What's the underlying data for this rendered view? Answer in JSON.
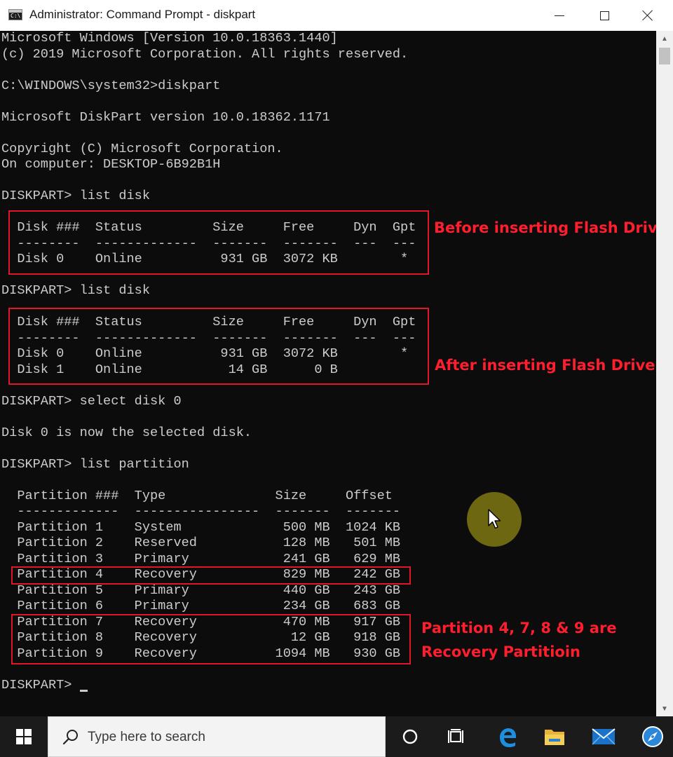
{
  "window": {
    "title": "Administrator: Command Prompt - diskpart",
    "icon_label": "C:\\",
    "minimize_icon": "minimize-icon",
    "maximize_icon": "maximize-icon",
    "close_icon": "close-icon"
  },
  "console": {
    "lines": [
      "Microsoft Windows [Version 10.0.18363.1440]",
      "(c) 2019 Microsoft Corporation. All rights reserved.",
      "",
      "C:\\WINDOWS\\system32>diskpart",
      "",
      "Microsoft DiskPart version 10.0.18362.1171",
      "",
      "Copyright (C) Microsoft Corporation.",
      "On computer: DESKTOP-6B92B1H",
      "",
      "DISKPART> list disk",
      "",
      "  Disk ###  Status         Size     Free     Dyn  Gpt",
      "  --------  -------------  -------  -------  ---  ---",
      "  Disk 0    Online          931 GB  3072 KB        *",
      "",
      "DISKPART> list disk",
      "",
      "  Disk ###  Status         Size     Free     Dyn  Gpt",
      "  --------  -------------  -------  -------  ---  ---",
      "  Disk 0    Online          931 GB  3072 KB        *",
      "  Disk 1    Online           14 GB      0 B",
      "",
      "DISKPART> select disk 0",
      "",
      "Disk 0 is now the selected disk.",
      "",
      "DISKPART> list partition",
      "",
      "  Partition ###  Type              Size     Offset",
      "  -------------  ----------------  -------  -------",
      "  Partition 1    System             500 MB  1024 KB",
      "  Partition 2    Reserved           128 MB   501 MB",
      "  Partition 3    Primary            241 GB   629 MB",
      "  Partition 4    Recovery           829 MB   242 GB",
      "  Partition 5    Primary            440 GB   243 GB",
      "  Partition 6    Primary            234 GB   683 GB",
      "  Partition 7    Recovery           470 MB   917 GB",
      "  Partition 8    Recovery            12 GB   918 GB",
      "  Partition 9    Recovery          1094 MB   930 GB",
      "",
      "DISKPART> "
    ],
    "text_color": "#cccccc",
    "background_color": "#0c0c0c"
  },
  "annotations": {
    "before": "Before inserting Flash Drive",
    "after": "After inserting Flash Drive",
    "partitions_line1": "Partition 4, 7, 8 & 9 are",
    "partitions_line2": "Recovery Partitioin",
    "color": "#ff1e2e"
  },
  "scrollbar": {
    "up_icon": "scroll-up-arrow-icon",
    "down_icon": "scroll-down-arrow-icon"
  },
  "taskbar": {
    "search_placeholder": "Type here to search",
    "icons": [
      "windows-start-icon",
      "search-icon",
      "cortana-icon",
      "task-view-icon",
      "edge-icon",
      "file-explorer-icon",
      "mail-icon",
      "app-icon"
    ]
  }
}
